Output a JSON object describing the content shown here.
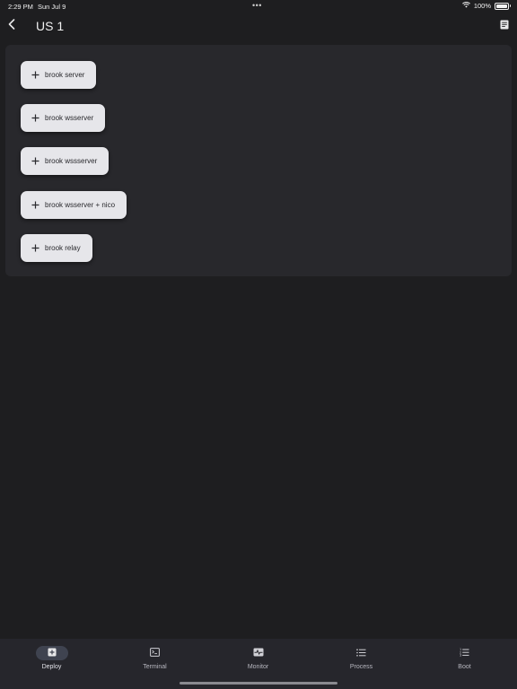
{
  "status_bar": {
    "time": "2:29 PM",
    "date": "Sun Jul 9",
    "dots": "•••",
    "battery": "100%",
    "wifi_icon": "wifi-icon",
    "battery_icon": "battery-icon"
  },
  "header": {
    "title": "US 1",
    "back_icon": "chevron-left-icon",
    "notes_icon": "notes-icon"
  },
  "actions": [
    {
      "label": "brook server",
      "icon": "plus-icon"
    },
    {
      "label": "brook wsserver",
      "icon": "plus-icon"
    },
    {
      "label": "brook wssserver",
      "icon": "plus-icon"
    },
    {
      "label": "brook wsserver + nico",
      "icon": "plus-icon"
    },
    {
      "label": "brook relay",
      "icon": "plus-icon"
    }
  ],
  "nav": {
    "items": [
      {
        "label": "Deploy",
        "icon": "plus-square-icon",
        "active": true
      },
      {
        "label": "Terminal",
        "icon": "terminal-icon",
        "active": false
      },
      {
        "label": "Monitor",
        "icon": "monitor-icon",
        "active": false
      },
      {
        "label": "Process",
        "icon": "list-icon",
        "active": false
      },
      {
        "label": "Boot",
        "icon": "numbered-list-icon",
        "active": false
      }
    ]
  },
  "colors": {
    "background": "#1e1e20",
    "card": "#28282c",
    "chip": "#e6e6ea",
    "nav_bar": "#26262c",
    "nav_active_pill": "#3f4350"
  }
}
